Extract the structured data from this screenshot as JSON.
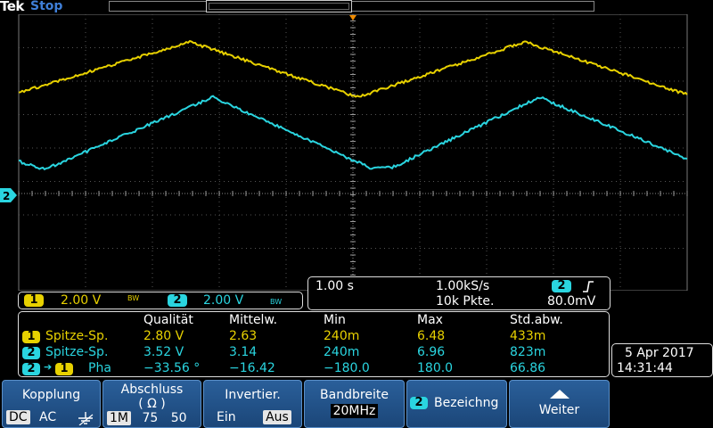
{
  "status": {
    "brand": "Tek",
    "acquisition": "Stop"
  },
  "trace_colors": {
    "ch1": "#e8d100",
    "ch2": "#2ad5e0",
    "accent": "#3f7fd8"
  },
  "channel_markers": {
    "ch2_ground": "2"
  },
  "vertical_settings": {
    "ch1": {
      "number": "1",
      "scale": "2.00 V",
      "bw_flag": "BW"
    },
    "ch2": {
      "number": "2",
      "scale": "2.00 V",
      "bw_flag": "BW"
    }
  },
  "horizontal": {
    "timebase": "1.00 s",
    "sample_rate": "1.00kS/s",
    "record_length": "10k Pkte.",
    "trigger_channel": "2",
    "trigger_slope_icon": "rising-edge-icon",
    "trigger_level": "80.0mV"
  },
  "measurements": {
    "headers": [
      "Qualität",
      "Mittelw.",
      "Min",
      "Max",
      "Std.abw."
    ],
    "rows": [
      {
        "ch": "1",
        "label": "Spitze-Sp.",
        "values": [
          "2.80 V",
          "2.63",
          "240m",
          "6.48",
          "433m"
        ]
      },
      {
        "ch": "2",
        "label": "Spitze-Sp.",
        "values": [
          "3.52 V",
          "3.14",
          "240m",
          "6.96",
          "823m"
        ]
      },
      {
        "ch": "2",
        "ch_to": "1",
        "label": "Pha",
        "values": [
          "−33.56 °",
          "−16.42",
          "−180.0",
          "180.0",
          "66.86"
        ]
      }
    ]
  },
  "datetime": {
    "date": "5 Apr 2017",
    "time": "14:31:44"
  },
  "menu": {
    "kopplung": {
      "title": "Kopplung",
      "opts": [
        "DC",
        "AC"
      ],
      "selected": "DC",
      "icon": "ground-icon"
    },
    "abschluss": {
      "title": "Abschluss",
      "unit": "( Ω )",
      "opts": [
        "1M",
        "75",
        "50"
      ],
      "selected": "1M"
    },
    "invertier": {
      "title": "Invertier.",
      "opts": [
        "Ein",
        "Aus"
      ],
      "selected": "Aus"
    },
    "bandbreite": {
      "title": "Bandbreite",
      "value": "20MHz"
    },
    "bezeichnung": {
      "ch": "2",
      "title": "Bezeichng"
    },
    "weiter": {
      "title": "Weiter",
      "icon": "chevron-up-icon"
    }
  }
}
